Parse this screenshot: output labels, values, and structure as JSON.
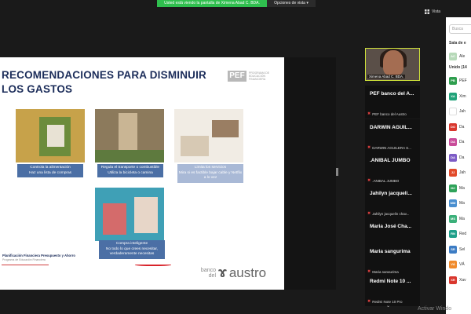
{
  "banner": {
    "sharing_text": "Usted está viendo la pantalla de Ximena Abad C. BDA.",
    "options_label": "Opciones de vista",
    "options_caret": "▾"
  },
  "view_button": {
    "label": "Vista",
    "icon": "grid-icon"
  },
  "slide": {
    "title": "RECOMENDACIONES PARA DISMINUIR LOS GASTOS",
    "pef_logo_mark": "PEF",
    "pef_logo_text": "PROGRAMA DE EDUCACIÓN FINANCIERA",
    "cards": [
      {
        "caption": "Controla la alimentación\nHaz una lista de compras",
        "colors": [
          "#c7a24a",
          "#6c8c3c",
          "#e8e2d4"
        ]
      },
      {
        "caption": "Regula el transporte o combustible\nUtiliza la bicicleta o camina",
        "colors": [
          "#8c7a5c",
          "#c9b594",
          "#5e7a3e"
        ]
      },
      {
        "caption": "Limita los servicios\nMira si es factible bajar cable y Netflix a lo vez",
        "colors": [
          "#d7c9b4",
          "#9a7e63",
          "#f1ece4"
        ]
      },
      {
        "caption": "Compra inteligente\nNo todo lo que crees necesitar, verdaderamente necesitas",
        "colors": [
          "#3fa0b6",
          "#d46b6b",
          "#e7d6c8"
        ]
      }
    ],
    "footer_line1": "Planificación Financiera Presupuesto y Ahorro",
    "footer_line2": "Programa de Educación Financiera",
    "bank_logo_small": "banco del",
    "bank_logo_mark": "ɤ",
    "bank_logo_big": "austro"
  },
  "active_speaker": {
    "label": "Ximena Abad C. BDA."
  },
  "tiles": [
    {
      "name": "PEF banco del A...",
      "sub": "PEF banco del Austro"
    },
    {
      "name": "DARWIN AGUIL...",
      "sub": "DARWIN AGUILERA S..."
    },
    {
      "name": ".ANIBAL JUMBO",
      "sub": ".ANIBAL JUMBO"
    },
    {
      "name": "Jahilyn jacqueli...",
      "sub": "Jahilyn jacquelin chav..."
    },
    {
      "name": "Maria José Cha...",
      "sub": "Maria José Chamba ..."
    },
    {
      "name": "Maria sangurima",
      "sub": "Maria sangurima"
    },
    {
      "name": "Redmi Note 10 ...",
      "sub": "Redmi Note 10 Pro"
    }
  ],
  "mic_icon_glyph": "✖",
  "tiles_down_glyph": "⌄",
  "panel": {
    "search_placeholder": "Busca",
    "waiting_label": "Sala de e",
    "waiting": [
      {
        "initials": "AC",
        "name": "Ale",
        "color": "#b7d9b9"
      }
    ],
    "joined_label": "Unido (14",
    "participants": [
      {
        "initials": "PB",
        "name": "PEF",
        "color": "#2e9e4e"
      },
      {
        "initials": "XA",
        "name": "Xim",
        "color": "#22a37a"
      },
      {
        "initials": "",
        "name": "Jah",
        "color": "#ffffff"
      },
      {
        "initials": "DO",
        "name": "Da",
        "color": "#d9372e"
      },
      {
        "initials": "DA",
        "name": "Da",
        "color": "#c94c9a"
      },
      {
        "initials": "DA",
        "name": "Da",
        "color": "#7d5cc6"
      },
      {
        "initials": "JJ",
        "name": "Jah",
        "color": "#e24a2a"
      },
      {
        "initials": "MJ",
        "name": "Ma",
        "color": "#2fa35a"
      },
      {
        "initials": "MM",
        "name": "Ma",
        "color": "#4a8fd0"
      },
      {
        "initials": "MS",
        "name": "Ma",
        "color": "#3bb07a"
      },
      {
        "initials": "RN",
        "name": "Red",
        "color": "#1f9f8a"
      },
      {
        "initials": "SR",
        "name": "Sel",
        "color": "#3c7cc4"
      },
      {
        "initials": "VÁ",
        "name": "VÁ",
        "color": "#f08a2a"
      },
      {
        "initials": "XR",
        "name": "Xav",
        "color": "#d9372e"
      }
    ]
  },
  "watermark": "Activar Windo"
}
